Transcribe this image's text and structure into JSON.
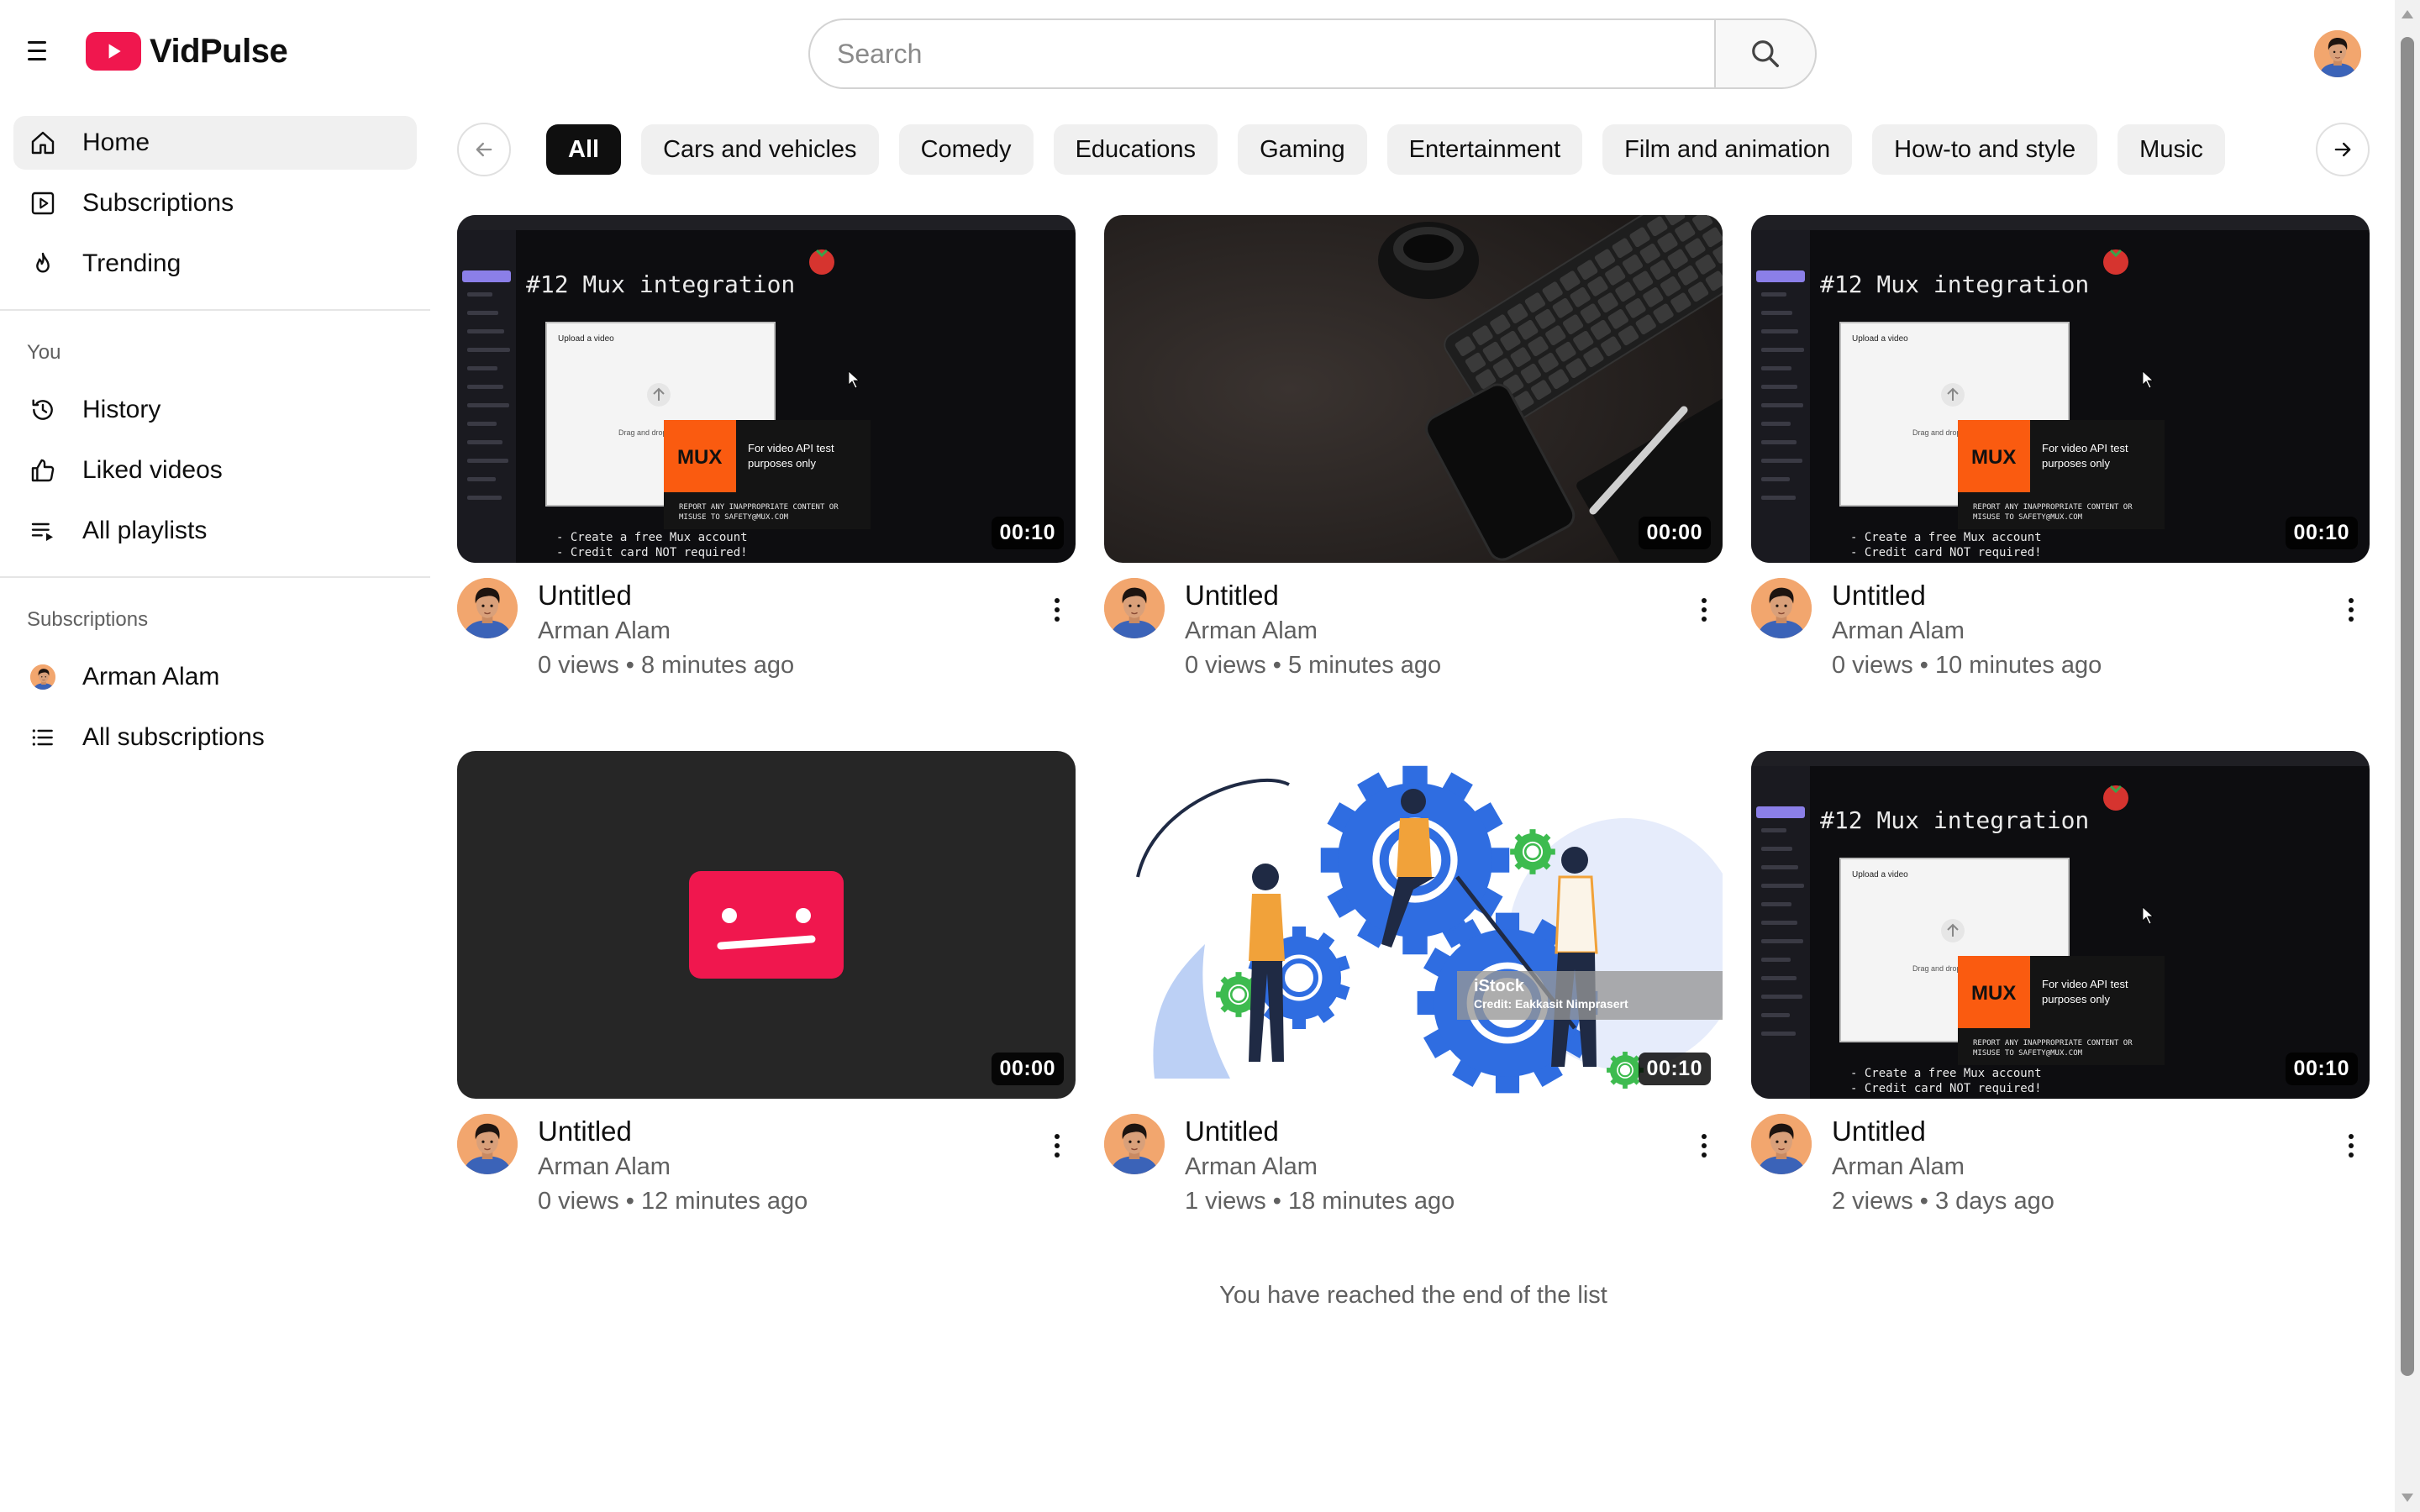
{
  "app": {
    "name": "VidPulse",
    "brand_color": "#f0174e"
  },
  "search": {
    "placeholder": "Search"
  },
  "sidebar": {
    "main": [
      {
        "label": "Home",
        "icon": "home-icon",
        "active": true
      },
      {
        "label": "Subscriptions",
        "icon": "subscriptions-icon"
      },
      {
        "label": "Trending",
        "icon": "flame-icon"
      }
    ],
    "you_heading": "You",
    "you": [
      {
        "label": "History",
        "icon": "history-icon"
      },
      {
        "label": "Liked videos",
        "icon": "thumbs-up-icon"
      },
      {
        "label": "All playlists",
        "icon": "playlist-icon"
      }
    ],
    "subscriptions_heading": "Subscriptions",
    "subscriptions": [
      {
        "label": "Arman Alam",
        "icon": "avatar"
      },
      {
        "label": "All subscriptions",
        "icon": "list-icon"
      }
    ]
  },
  "chips": [
    "All",
    "Cars and vehicles",
    "Comedy",
    "Educations",
    "Gaming",
    "Entertainment",
    "Film and animation",
    "How-to and style",
    "Music"
  ],
  "active_chip": "All",
  "videos": [
    {
      "title": "Untitled",
      "channel": "Arman Alam",
      "views": "0 views",
      "age": "8 minutes ago",
      "duration": "00:10",
      "thumb": "mux"
    },
    {
      "title": "Untitled",
      "channel": "Arman Alam",
      "views": "0 views",
      "age": "5 minutes ago",
      "duration": "00:00",
      "thumb": "desk"
    },
    {
      "title": "Untitled",
      "channel": "Arman Alam",
      "views": "0 views",
      "age": "10 minutes ago",
      "duration": "00:10",
      "thumb": "mux"
    },
    {
      "title": "Untitled",
      "channel": "Arman Alam",
      "views": "0 views",
      "age": "12 minutes ago",
      "duration": "00:00",
      "thumb": "error"
    },
    {
      "title": "Untitled",
      "channel": "Arman Alam",
      "views": "1 views",
      "age": "18 minutes ago",
      "duration": "00:10",
      "thumb": "gears"
    },
    {
      "title": "Untitled",
      "channel": "Arman Alam",
      "views": "2 views",
      "age": "3 days ago",
      "duration": "00:10",
      "thumb": "mux"
    }
  ],
  "stats_separator": "•",
  "thumb_text": {
    "mux_heading": "#12 Mux integration",
    "mux_upload": "Upload a video",
    "mux_drag": "Drag and drop video",
    "mux_logo": "MUX",
    "mux_badge_1": "For video API test",
    "mux_badge_2": "purposes only",
    "mux_report_1": "REPORT ANY INAPPROPRIATE CONTENT OR",
    "mux_report_2": "MISUSE TO SAFETY@MUX.COM",
    "mux_note_1": "- Create a free Mux account",
    "mux_note_2": "- Credit card NOT required!",
    "stock_brand": "iStock",
    "stock_credit": "Credit: Eakkasit Nimprasert"
  },
  "end_note": "You have reached the end of the list"
}
